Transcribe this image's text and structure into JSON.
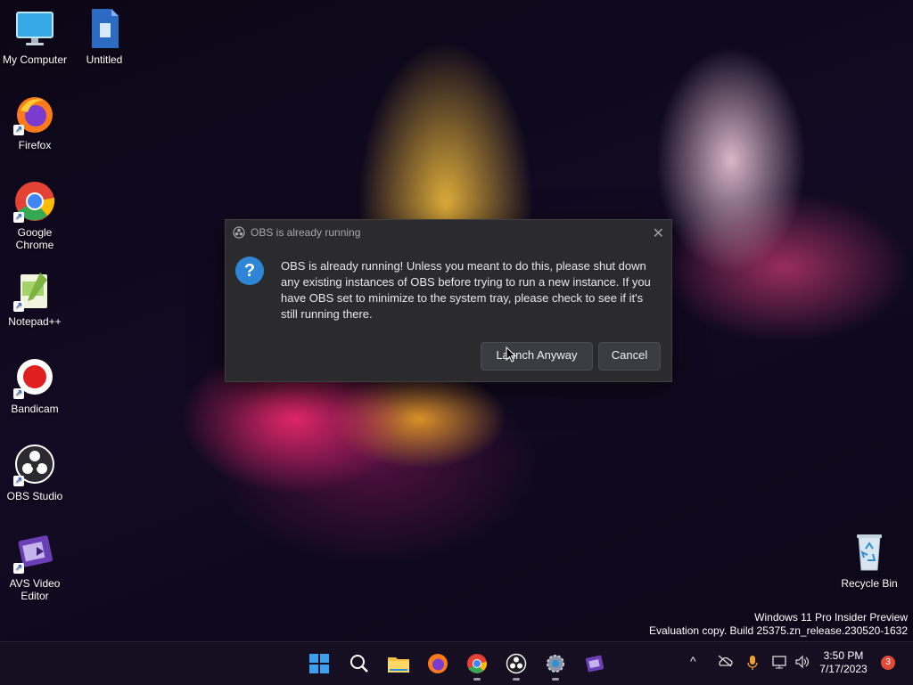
{
  "desktop": {
    "icons": [
      {
        "label": "My Computer"
      },
      {
        "label": "Untitled"
      },
      {
        "label": "Firefox"
      },
      {
        "label": "Google Chrome"
      },
      {
        "label": "Notepad++"
      },
      {
        "label": "Bandicam"
      },
      {
        "label": "OBS Studio"
      },
      {
        "label": "AVS Video Editor"
      },
      {
        "label": "Recycle Bin"
      }
    ]
  },
  "dialog": {
    "title": "OBS is already running",
    "message": "OBS is already running! Unless you meant to do this, please shut down any existing instances of OBS before trying to run a new instance. If you have OBS set to minimize to the system tray, please check to see if it's still running there.",
    "launch_label": "Launch Anyway",
    "cancel_label": "Cancel",
    "close_glyph": "✕",
    "question_glyph": "?"
  },
  "watermark": {
    "line1": "Windows 11 Pro Insider Preview",
    "line2": "Evaluation copy. Build 25375.zn_release.230520-1632"
  },
  "taskbar": {
    "apps": [
      "start-icon",
      "search-icon",
      "file-explorer-icon",
      "firefox-icon",
      "chrome-icon",
      "obs-icon",
      "settings-icon",
      "avs-video-editor-icon"
    ],
    "tray": {
      "chevron": "^",
      "time": "3:50 PM",
      "date": "7/17/2023",
      "notification_count": "3"
    }
  },
  "colors": {
    "dialog_bg": "#2b2b2e",
    "button_bg": "#3b3b42",
    "question_blue": "#2f86d6",
    "taskbar_bg": "#161022"
  }
}
